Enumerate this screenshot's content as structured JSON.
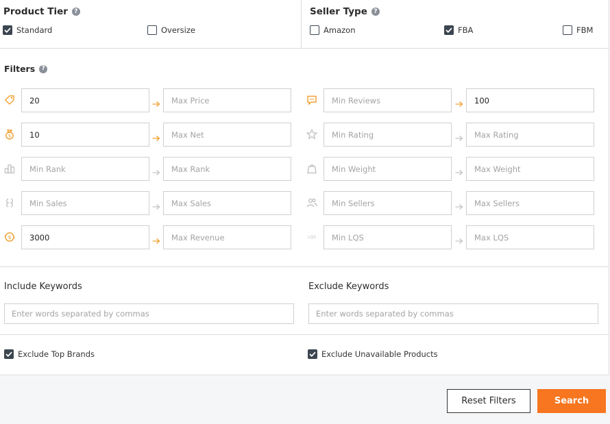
{
  "product_tier": {
    "title": "Product Tier",
    "options": [
      {
        "label": "Standard",
        "checked": true
      },
      {
        "label": "Oversize",
        "checked": false
      }
    ]
  },
  "seller_type": {
    "title": "Seller Type",
    "options": [
      {
        "label": "Amazon",
        "checked": false
      },
      {
        "label": "FBA",
        "checked": true
      },
      {
        "label": "FBM",
        "checked": false
      }
    ]
  },
  "filters": {
    "title": "Filters",
    "left": [
      {
        "icon": "price-tag-icon",
        "min_value": "20",
        "min_placeholder": "",
        "max_value": "",
        "max_placeholder": "Max Price",
        "active": true
      },
      {
        "icon": "money-bag-icon",
        "min_value": "10",
        "min_placeholder": "",
        "max_value": "",
        "max_placeholder": "Max Net",
        "active": true
      },
      {
        "icon": "rank-bars-icon",
        "min_value": "",
        "min_placeholder": "Min Rank",
        "max_value": "",
        "max_placeholder": "Max Rank",
        "active": false
      },
      {
        "icon": "sales-coin-icon",
        "min_value": "",
        "min_placeholder": "Min Sales",
        "max_value": "",
        "max_placeholder": "Max Sales",
        "active": false
      },
      {
        "icon": "revenue-coin-icon",
        "min_value": "3000",
        "min_placeholder": "",
        "max_value": "",
        "max_placeholder": "Max Revenue",
        "active": true
      }
    ],
    "right": [
      {
        "icon": "reviews-speech-icon",
        "min_value": "",
        "min_placeholder": "Min Reviews",
        "max_value": "100",
        "max_placeholder": "",
        "active": true
      },
      {
        "icon": "star-icon",
        "min_value": "",
        "min_placeholder": "Min Rating",
        "max_value": "",
        "max_placeholder": "Max Rating",
        "active": false
      },
      {
        "icon": "weight-icon",
        "min_value": "",
        "min_placeholder": "Min Weight",
        "max_value": "",
        "max_placeholder": "Max Weight",
        "active": false
      },
      {
        "icon": "sellers-people-icon",
        "min_value": "",
        "min_placeholder": "Min Sellers",
        "max_value": "",
        "max_placeholder": "Max Sellers",
        "active": false
      },
      {
        "icon": "lqs-icon",
        "min_value": "",
        "min_placeholder": "Min LQS",
        "max_value": "",
        "max_placeholder": "Max LQS",
        "active": false
      }
    ]
  },
  "keywords": {
    "include_title": "Include Keywords",
    "include_placeholder": "Enter words separated by commas",
    "exclude_title": "Exclude Keywords",
    "exclude_placeholder": "Enter words separated by commas"
  },
  "exclusions": {
    "top_brands": {
      "label": "Exclude Top Brands",
      "checked": true
    },
    "unavailable": {
      "label": "Exclude Unavailable Products",
      "checked": true
    }
  },
  "actions": {
    "reset_label": "Reset Filters",
    "search_label": "Search"
  },
  "colors": {
    "accent": "#f7761f",
    "icon_active": "#f0a030",
    "icon_inactive": "#c4c4c4",
    "checkbox": "#3c4651"
  }
}
